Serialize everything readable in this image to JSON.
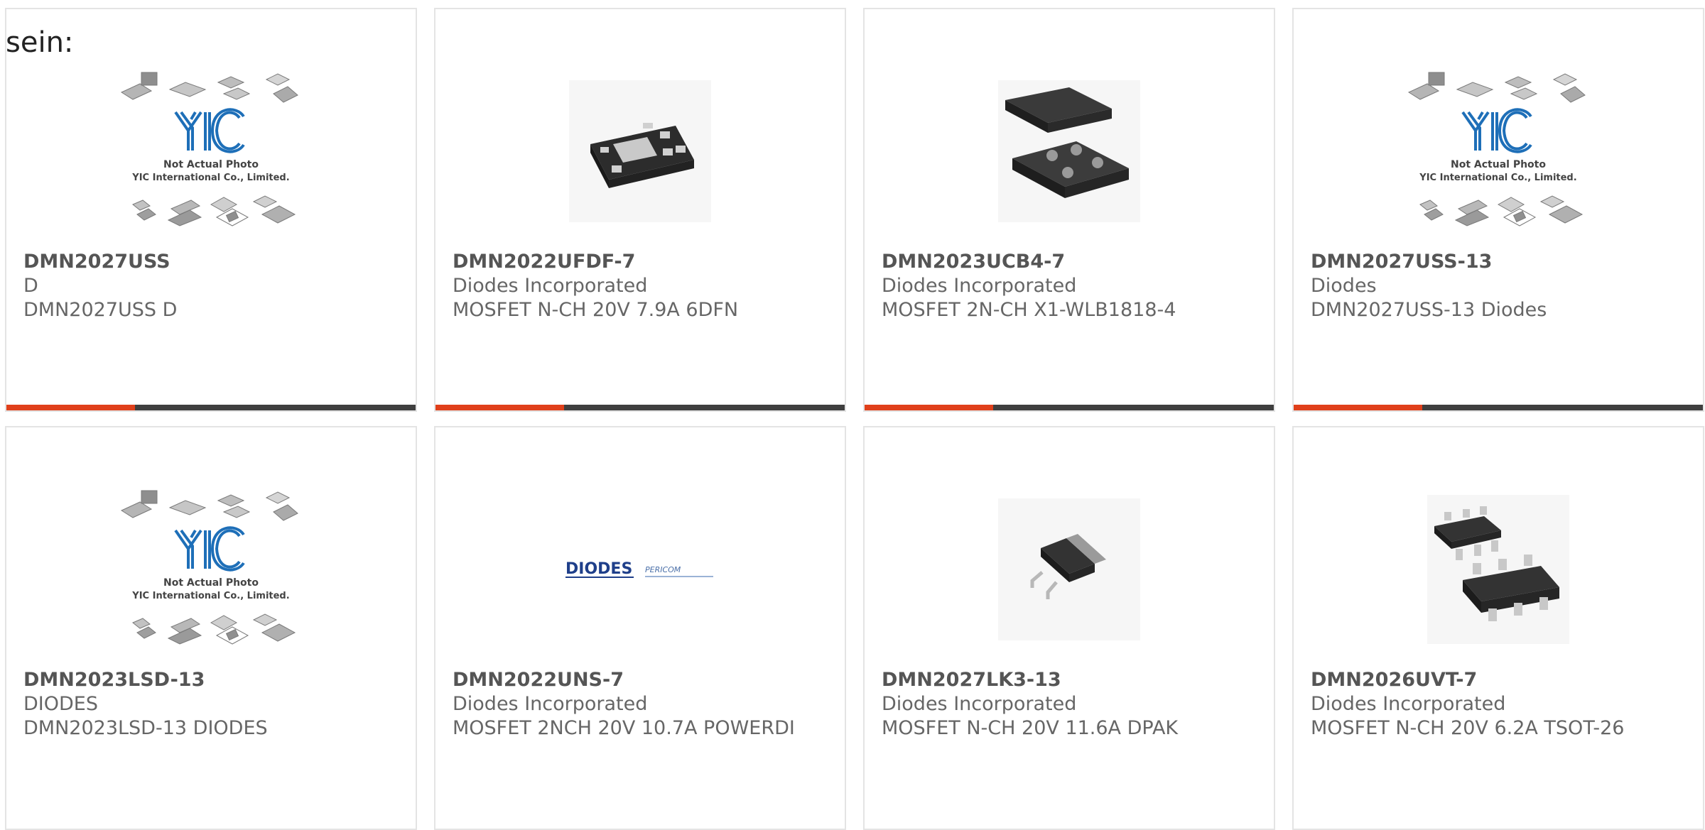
{
  "page": {
    "fragment_label": "sein:"
  },
  "placeholder": {
    "line1": "Not Actual Photo",
    "line2": "YIC International Co., Limited.",
    "logo": "YIC"
  },
  "colors": {
    "accent": "#e0401b",
    "bar": "#3f3f3f",
    "border": "#e4e4e4",
    "yic_blue": "#1e6fb8"
  },
  "products": [
    {
      "part_number": "DMN2027USS",
      "manufacturer": "D",
      "description": "DMN2027USS D",
      "image": "placeholder-photo",
      "has_bar": true
    },
    {
      "part_number": "DMN2022UFDF-7",
      "manufacturer": "Diodes Incorporated",
      "description": "MOSFET N-CH 20V 7.9A 6DFN",
      "image": "dfn-package-photo",
      "has_bar": true
    },
    {
      "part_number": "DMN2023UCB4-7",
      "manufacturer": "Diodes Incorporated",
      "description": "MOSFET 2N-CH X1-WLB1818-4",
      "image": "wlb-chip-photo",
      "has_bar": true
    },
    {
      "part_number": "DMN2027USS-13",
      "manufacturer": "Diodes",
      "description": "DMN2027USS-13 Diodes",
      "image": "placeholder-photo",
      "has_bar": true
    },
    {
      "part_number": "DMN2023LSD-13",
      "manufacturer": "DIODES",
      "description": "DMN2023LSD-13 DIODES",
      "image": "placeholder-photo",
      "has_bar": false
    },
    {
      "part_number": "DMN2022UNS-7",
      "manufacturer": "Diodes Incorporated",
      "description": "MOSFET 2NCH 20V 10.7A POWERDI",
      "image": "diodes-pericom-logo",
      "has_bar": false
    },
    {
      "part_number": "DMN2027LK3-13",
      "manufacturer": "Diodes Incorporated",
      "description": "MOSFET N-CH 20V 11.6A DPAK",
      "image": "dpak-package-photo",
      "has_bar": false
    },
    {
      "part_number": "DMN2026UVT-7",
      "manufacturer": "Diodes Incorporated",
      "description": "MOSFET N-CH 20V 6.2A TSOT-26",
      "image": "tsot-package-photo",
      "has_bar": false
    }
  ],
  "logos": {
    "diodes": "DIODES",
    "pericom": "PERICOM"
  }
}
